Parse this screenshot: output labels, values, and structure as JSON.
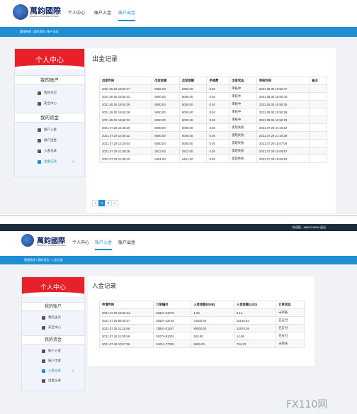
{
  "top": {
    "logo_cn": "萬鈞國際",
    "logo_en": "WANJUN INTERNATIONAL",
    "nav": [
      "个人中心",
      "账户入金",
      "账户出金"
    ],
    "breadcrumb": "管理系统 / 我的资金 / 账户出金",
    "sidebar": {
      "banner": "个人中心",
      "sec1": "我的账户",
      "items1": [
        "我的主页",
        "安全中心"
      ],
      "sec2": "我的资金",
      "items2": [
        "账户入金",
        "账户出金",
        "入金记录",
        "出金记录"
      ]
    },
    "title": "出金记录",
    "headers": [
      "出金时间",
      "出金金额",
      "实际金额",
      "手续费",
      "出金状态",
      "审核时间",
      "备注"
    ],
    "rows": [
      [
        "2021.08.05 19:50:47",
        "6356.00",
        "6356.00",
        "0.00",
        "审核中",
        "2021.08.05 19:50:47",
        ""
      ],
      [
        "2021.08.05 19:50:43",
        "5000.00",
        "5000.00",
        "0.00",
        "审核中",
        "2021.08.05 19:50:43",
        ""
      ],
      [
        "2021.08.05 19:50:39",
        "5000.00",
        "5000.00",
        "0.00",
        "审核中",
        "2021.08.05 19:50:39",
        ""
      ],
      [
        "2021.08.05 19:50:28",
        "5000.00",
        "5000.00",
        "0.00",
        "审核中",
        "2021.08.05 19:50:28",
        ""
      ],
      [
        "2021.08.05 19:50:23",
        "5000.00",
        "5000.00",
        "0.00",
        "审核中",
        "2021.08.05 19:50:23",
        ""
      ],
      [
        "2021.07.29 15:48:29",
        "5000.00",
        "5000.00",
        "0.00",
        "提现失败",
        "2021.07.29 21:19:22",
        ""
      ],
      [
        "2021.07.29 10:48:22",
        "5000.00",
        "5000.00",
        "0.00",
        "提现失败",
        "2021.07.29 21:19:29",
        ""
      ],
      [
        "2021.07.29 13:28:04",
        "5000.00",
        "5000.00",
        "0.00",
        "提现失败",
        "2021.07.29 15:07:06",
        ""
      ],
      [
        "2021.07.29 11:08:25",
        "3813.00",
        "3813.00",
        "0.00",
        "提现失败",
        "2021.07.29 15:06:57",
        ""
      ],
      [
        "2021.07.29 11:08:13",
        "6451.00",
        "6451.00",
        "0.00",
        "提现失败",
        "2021.07.29 15:06:52",
        ""
      ]
    ],
    "pager": [
      "«",
      "1",
      "2",
      "»"
    ]
  },
  "bottom": {
    "user_bar": "欢迎您，8880018666 退出",
    "logo_cn": "萬鈞國際",
    "logo_en": "WANJUN INTERNATIONAL",
    "nav": [
      "个人中心",
      "账户入金",
      "账户出金"
    ],
    "breadcrumb": "管理系统 / 我的资金 / 入金记录",
    "sidebar": {
      "banner": "个人中心",
      "sec1": "我的账户",
      "items1": [
        "我的主页",
        "安全中心"
      ],
      "sec2": "我的资金",
      "items2": [
        "账户入金",
        "账户出金",
        "入金记录",
        "出金记录"
      ]
    },
    "title": "入金记录",
    "headers": [
      "申请时间",
      "订单编号",
      "入金金额(RMB)",
      "入金金额(USD)",
      "订单状态"
    ],
    "rows": [
      [
        "2021.07.29 15:56:44",
        "52651-01070",
        "1.00",
        "0.14",
        "未审核"
      ],
      [
        "2021.07.29 09:45:27",
        "20507-23716",
        "72000.00",
        "10140.84",
        "已支付"
      ],
      [
        "2021.07.28 11:15:59",
        "75501-01197",
        "90000.00",
        "12676.05",
        "已支付"
      ],
      [
        "2021.07.28 11:05:59",
        "01074-91001",
        "100.00",
        "14.08",
        "已支付"
      ],
      [
        "2021.07.28 10:57:06",
        "04012-77005",
        "5000.00",
        "704.23",
        "未审核"
      ]
    ]
  },
  "watermark": "FX110网",
  "colors": {
    "accent": "#1e8fd2",
    "banner": "#e8202a",
    "dark": "#1c2b3e"
  }
}
